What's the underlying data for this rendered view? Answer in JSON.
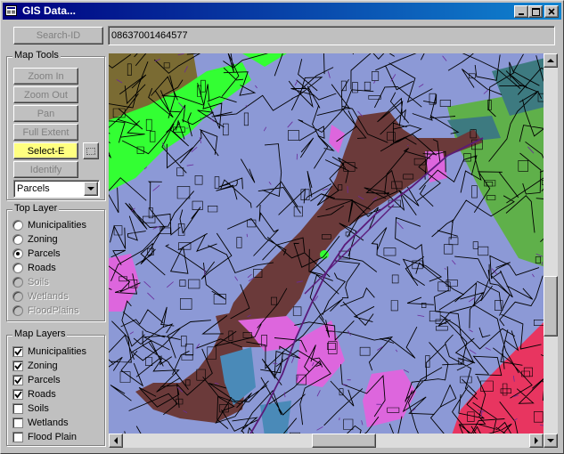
{
  "window": {
    "title": "GIS Data...",
    "minimize_icon": "minimize-icon",
    "maximize_icon": "maximize-icon",
    "close_icon": "close-icon",
    "accent": "#000080"
  },
  "search": {
    "button_label": "Search-ID",
    "value": "08637001464577"
  },
  "map_tools": {
    "label": "Map Tools",
    "buttons": [
      {
        "label": "Zoom In"
      },
      {
        "label": "Zoom Out"
      },
      {
        "label": "Pan"
      },
      {
        "label": "Full Extent"
      },
      {
        "label": "Select-E",
        "active": true,
        "color": "#ffff80"
      },
      {
        "label": "Identify"
      }
    ],
    "layer_select": "Parcels"
  },
  "top_layer": {
    "label": "Top Layer",
    "options": [
      {
        "label": "Municipalities",
        "selected": false,
        "enabled": true
      },
      {
        "label": "Zoning",
        "selected": false,
        "enabled": true
      },
      {
        "label": "Parcels",
        "selected": true,
        "enabled": true
      },
      {
        "label": "Roads",
        "selected": false,
        "enabled": true
      },
      {
        "label": "Soils",
        "selected": false,
        "enabled": false
      },
      {
        "label": "Wetlands",
        "selected": false,
        "enabled": false
      },
      {
        "label": "FloodPlains",
        "selected": false,
        "enabled": false
      }
    ]
  },
  "map_layers": {
    "label": "Map Layers",
    "items": [
      {
        "label": "Municipalities",
        "checked": true
      },
      {
        "label": "Zoning",
        "checked": true
      },
      {
        "label": "Parcels",
        "checked": true
      },
      {
        "label": "Roads",
        "checked": true
      },
      {
        "label": "Soils",
        "checked": false
      },
      {
        "label": "Wetlands",
        "checked": false
      },
      {
        "label": "Flood Plain",
        "checked": false
      }
    ]
  },
  "map": {
    "colors": {
      "residential": "#8c99d6",
      "commercial": "#6b3a3a",
      "green": "#33ff33",
      "olive": "#7a6b33",
      "pink": "#dd66dd",
      "red": "#e83560",
      "teal": "#3d7a80",
      "grass": "#5fb04a"
    }
  }
}
